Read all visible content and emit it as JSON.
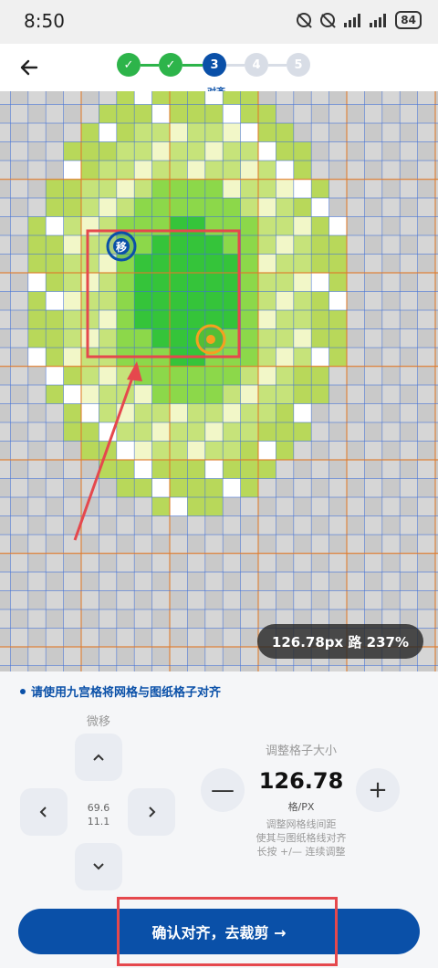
{
  "status_bar": {
    "time": "8:50",
    "battery": "84"
  },
  "stepper": {
    "steps": [
      {
        "label": "✓",
        "state": "done"
      },
      {
        "label": "✓",
        "state": "done"
      },
      {
        "label": "3",
        "state": "current"
      },
      {
        "label": "4",
        "state": "todo"
      },
      {
        "label": "5",
        "state": "todo"
      }
    ],
    "current_caption": "对齐"
  },
  "canvas": {
    "zoom_badge": "126.78px 路 237%",
    "move_handle_label": "移",
    "colors": {
      "accent": "#0a50a8",
      "highlight_frame": "#e5484d",
      "handle_orange": "#f5a020",
      "grid_blue": "#3f6fd8",
      "grid_orange": "#e07a2a"
    }
  },
  "controls": {
    "hint": "请使用九宫格将网格与图纸格子对齐",
    "nudge_title": "微移",
    "offset_x": "69.6",
    "offset_y": "11.1",
    "size_title": "调整格子大小",
    "size_value": "126.78",
    "size_unit": "格/PX",
    "size_desc_line1": "调整网格线间距",
    "size_desc_line2": "使其与图纸格线对齐",
    "size_desc_line3": "长按 +/— 连续调整",
    "minus_label": "—",
    "plus_label": "+"
  },
  "confirm_button": {
    "label": "确认对齐，去裁剪 →"
  }
}
